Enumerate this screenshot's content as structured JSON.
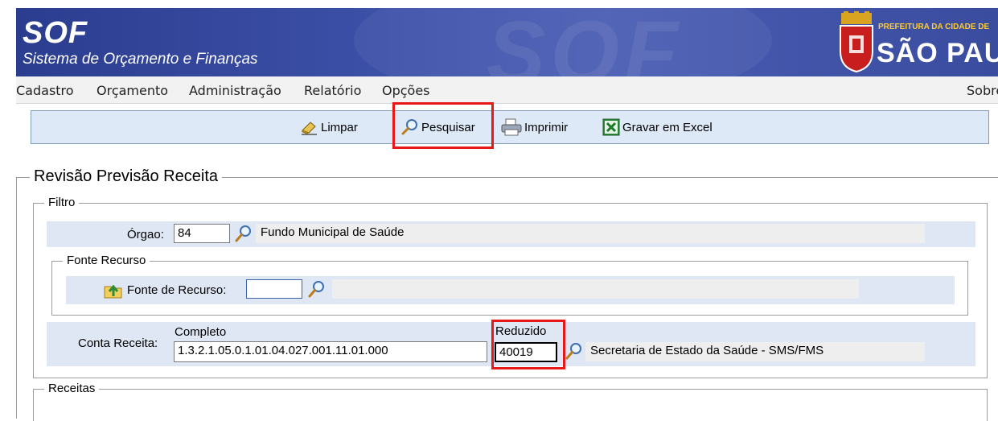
{
  "header": {
    "brand": "SOF",
    "subtitle": "Sistema de Orçamento e Finanças",
    "watermark": "SOF",
    "logo_top": "PREFEITURA DA CIDADE DE",
    "logo_city": "SÃO PAULO"
  },
  "menu": {
    "items": [
      "Cadastro",
      "Orçamento",
      "Administração",
      "Relatório",
      "Opções"
    ],
    "right": "Sobre"
  },
  "toolbar": {
    "limpar": "Limpar",
    "pesquisar": "Pesquisar",
    "imprimir": "Imprimir",
    "excel": "Gravar em Excel"
  },
  "form": {
    "title": "Revisão Previsão Receita",
    "filtro_legend": "Filtro",
    "orgao_label": "Órgao:",
    "orgao_value": "84",
    "orgao_desc": "Fundo Municipal de Saúde",
    "fonte_legend": "Fonte Recurso",
    "fonte_label": "Fonte de Recurso:",
    "fonte_value": "",
    "fonte_desc": "",
    "conta_label": "Conta Receita:",
    "completo_label": "Completo",
    "completo_value": "1.3.2.1.05.0.1.01.04.027.001.11.01.000",
    "reduzido_label": "Reduzido",
    "reduzido_value": "40019",
    "conta_desc": "Secretaria de Estado da Saúde - SMS/FMS",
    "receitas_legend": "Receitas"
  },
  "colors": {
    "banner": "#3b4fa6",
    "toolbar_bg": "#dde9f7",
    "row_bg": "#dfe7f4",
    "highlight": "#e81818"
  }
}
